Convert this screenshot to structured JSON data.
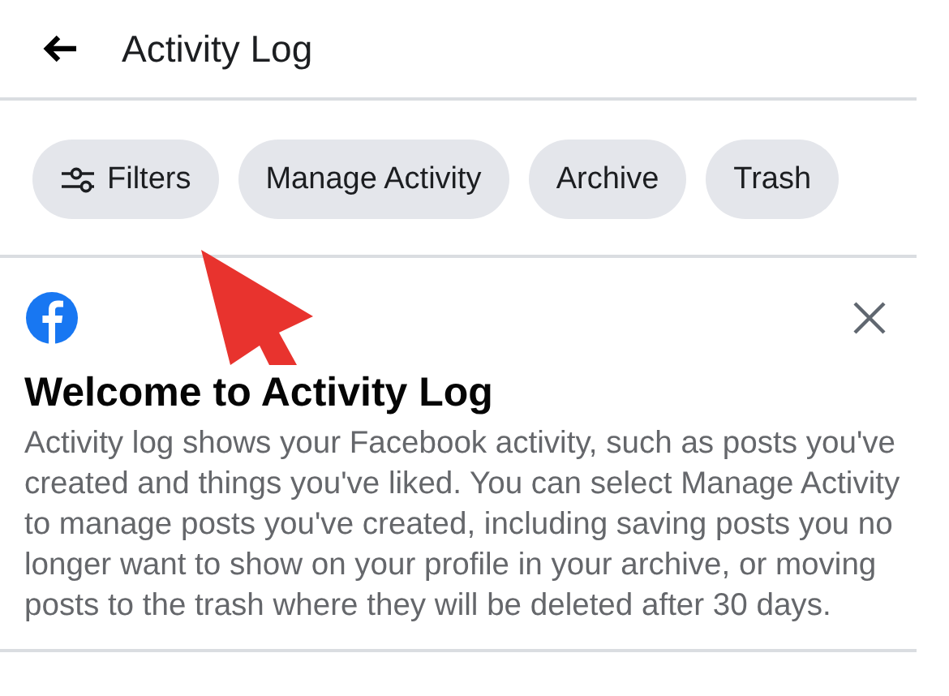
{
  "header": {
    "title": "Activity Log"
  },
  "chips": [
    {
      "label": "Filters",
      "kind": "filter"
    },
    {
      "label": "Manage Activity",
      "kind": "plain"
    },
    {
      "label": "Archive",
      "kind": "plain"
    },
    {
      "label": "Trash",
      "kind": "plain"
    }
  ],
  "welcome_card": {
    "heading": "Welcome to Activity Log",
    "body": "Activity log shows your Facebook activity, such as posts you've created and things you've liked. You can select Manage Activity to manage posts you've created, including saving posts you no longer want to show on your profile in your archive, or moving posts to the trash where they will be deleted after 30 days."
  }
}
